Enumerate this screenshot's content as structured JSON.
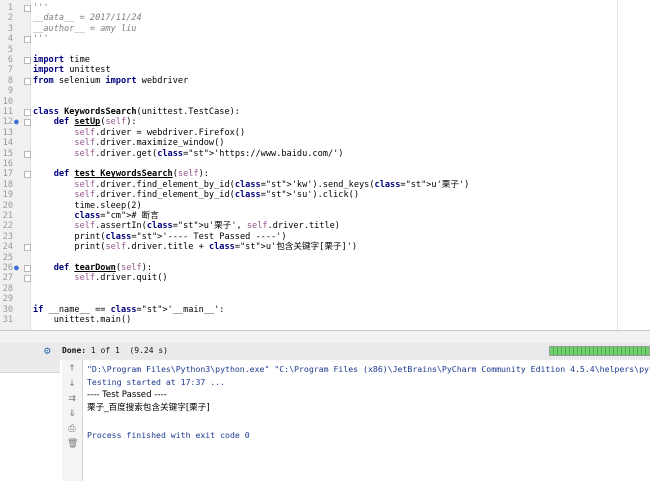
{
  "editor": {
    "lines": [
      {
        "n": "1",
        "text": "'''",
        "cls": "cm"
      },
      {
        "n": "2",
        "text": "__data__ = 2017/11/24",
        "cls": "cm"
      },
      {
        "n": "3",
        "text": "__author__ = amy liu",
        "cls": "cm"
      },
      {
        "n": "4",
        "text": "'''",
        "cls": "cm"
      },
      {
        "n": "5",
        "text": ""
      },
      {
        "n": "6",
        "text": "import time"
      },
      {
        "n": "7",
        "text": "import unittest"
      },
      {
        "n": "8",
        "text": "from selenium import webdriver"
      },
      {
        "n": "9",
        "text": ""
      },
      {
        "n": "10",
        "text": ""
      },
      {
        "n": "11",
        "text": "class KeywordsSearch(unittest.TestCase):"
      },
      {
        "n": "12",
        "text": "    def setUp(self):"
      },
      {
        "n": "13",
        "text": "        self.driver = webdriver.Firefox()"
      },
      {
        "n": "14",
        "text": "        self.driver.maximize_window()"
      },
      {
        "n": "15",
        "text": "        self.driver.get('https://www.baidu.com/')"
      },
      {
        "n": "16",
        "text": ""
      },
      {
        "n": "17",
        "text": "    def test_KeywordsSearch(self):"
      },
      {
        "n": "18",
        "text": "        self.driver.find_element_by_id('kw').send_keys(u'栗子')"
      },
      {
        "n": "19",
        "text": "        self.driver.find_element_by_id('su').click()"
      },
      {
        "n": "20",
        "text": "        time.sleep(2)"
      },
      {
        "n": "21",
        "text": "        # 断言"
      },
      {
        "n": "22",
        "text": "        self.assertIn(u'栗子', self.driver.title)"
      },
      {
        "n": "23",
        "text": "        print('---- Test Passed ----')"
      },
      {
        "n": "24",
        "text": "        print(self.driver.title + u'包含关键字[栗子]')"
      },
      {
        "n": "25",
        "text": ""
      },
      {
        "n": "26",
        "text": "    def tearDown(self):"
      },
      {
        "n": "27",
        "text": "        self.driver.quit()"
      },
      {
        "n": "28",
        "text": ""
      },
      {
        "n": "29",
        "text": ""
      },
      {
        "n": "30",
        "text": "if __name__ == '__main__':"
      },
      {
        "n": "31",
        "text": "    unittest.main()"
      }
    ]
  },
  "run": {
    "status_done": "Done:",
    "status_rest": " 1 of 1  (9.24 s)",
    "progress": 1.0,
    "progress_color": "#5bc55b"
  },
  "console": {
    "command": "\"D:\\Program Files\\Python3\\python.exe\" \"C:\\Program Files (x86)\\JetBrains\\PyCharm Community Edition 4.5.4\\helpers\\pycharm\\utrunner.py\"",
    "started": "Testing started at 17:37 ...",
    "passed": "---- Test Passed ----",
    "title_line": "栗子_百度搜索包含关键字[栗子]",
    "finished": "Process finished with exit code 0"
  },
  "colors": {
    "keyword": "#000080",
    "string": "#008000",
    "comment": "#808080",
    "self": "#94558d",
    "console_info": "#1c3a8f"
  },
  "tools": {
    "up": "↑",
    "down": "↓",
    "wrap": "⇉",
    "scroll": "⇓",
    "print": "⎙",
    "trash": "🗑"
  }
}
